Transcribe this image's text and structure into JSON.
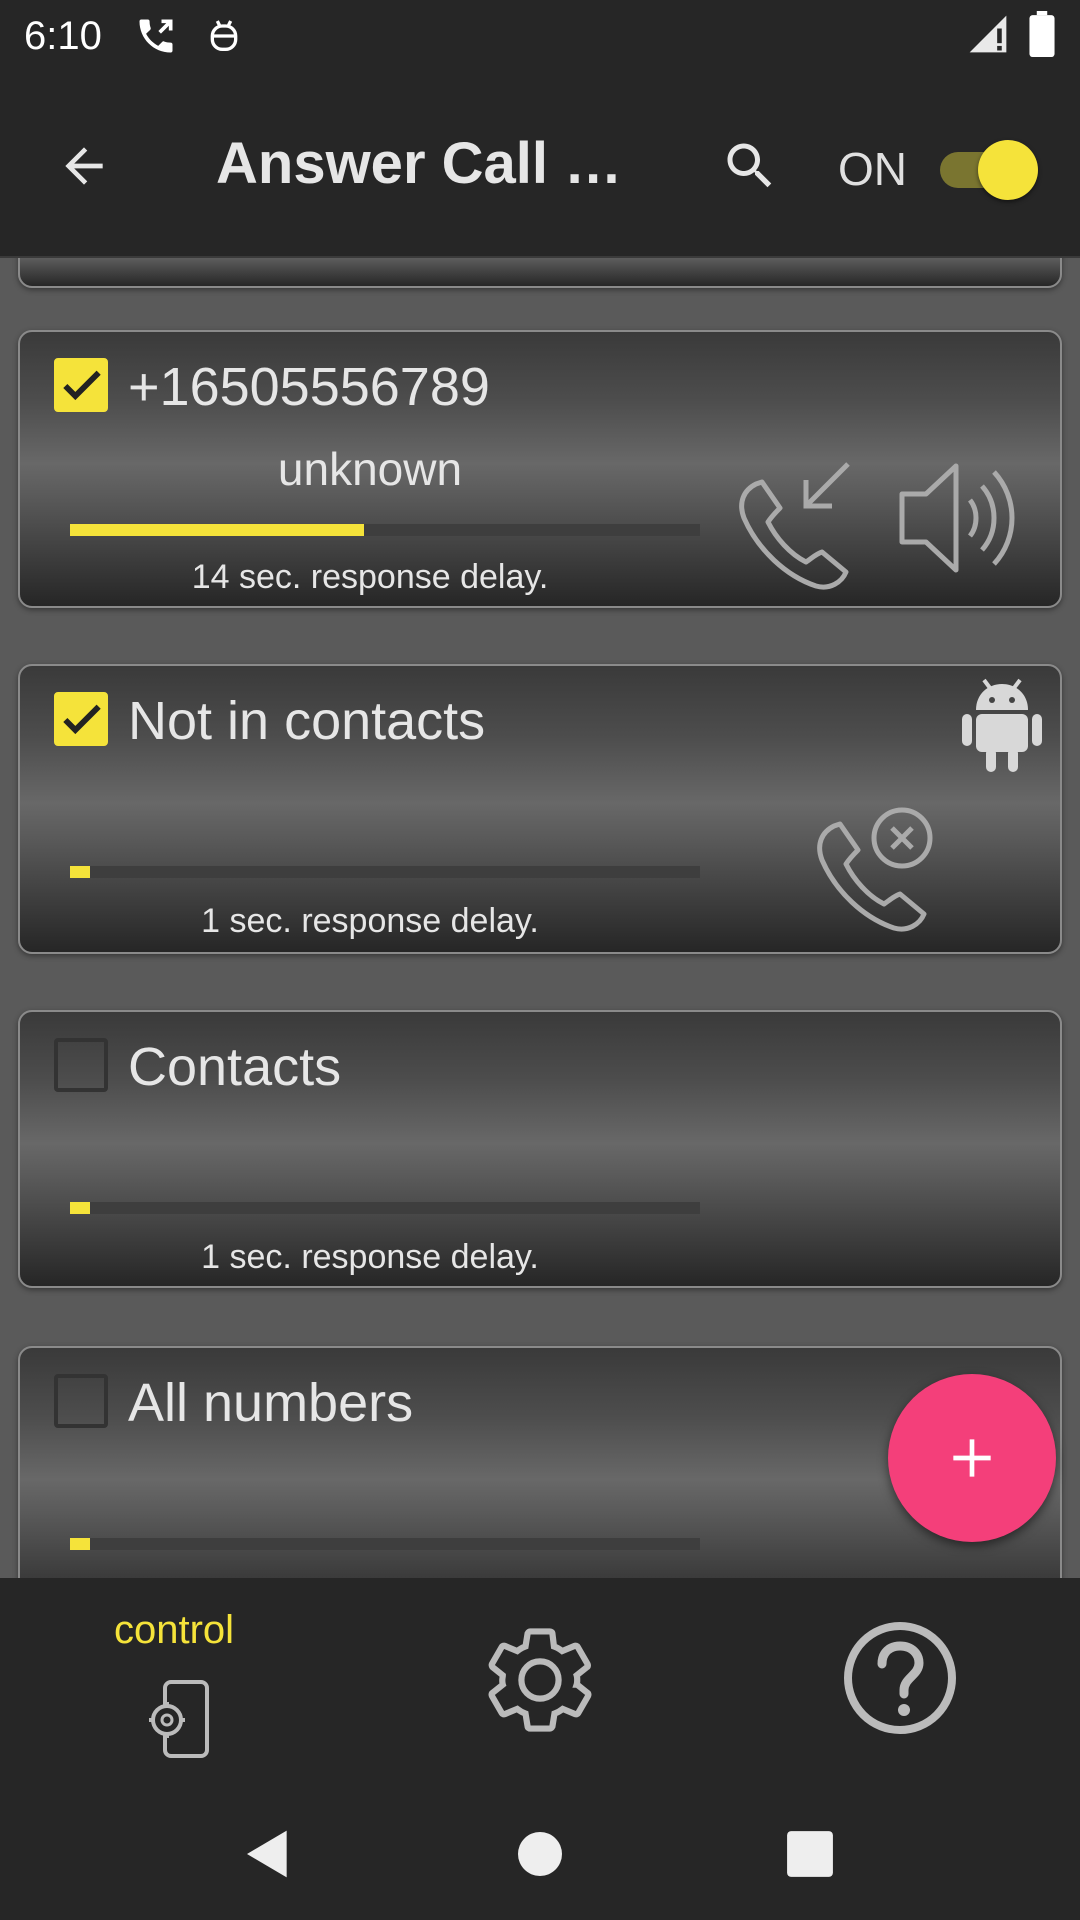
{
  "status_bar": {
    "time": "6:10",
    "icons": [
      "phone-forwarded-icon",
      "android-debug-icon",
      "signal-icon",
      "battery-icon"
    ]
  },
  "app_bar": {
    "title": "Answer Call b…",
    "toggle_label": "ON",
    "toggle_on": true
  },
  "rules": [
    {
      "title": "+16505556789",
      "subtitle": "unknown",
      "checked": true,
      "progress": 0.47,
      "delay_text": "14 sec. response delay.",
      "icons": [
        "incoming-call-icon",
        "speaker-icon"
      ]
    },
    {
      "title": "Not in contacts",
      "subtitle": "",
      "checked": true,
      "progress": 0.03,
      "delay_text": "1 sec. response delay.",
      "icons": [
        "android-icon",
        "call-blocked-icon"
      ]
    },
    {
      "title": "Contacts",
      "subtitle": "",
      "checked": false,
      "progress": 0.03,
      "delay_text": "1 sec. response delay.",
      "icons": []
    },
    {
      "title": "All numbers",
      "subtitle": "",
      "checked": false,
      "progress": 0.03,
      "delay_text": "",
      "icons": []
    }
  ],
  "fab": {
    "icon": "plus-icon"
  },
  "bottom_nav": {
    "items": [
      {
        "label": "control",
        "icon": "phone-settings-icon",
        "active": true
      },
      {
        "label": "",
        "icon": "gear-icon",
        "active": false
      },
      {
        "label": "",
        "icon": "help-icon",
        "active": false
      }
    ]
  },
  "system_nav": {
    "icons": [
      "back-icon",
      "home-icon",
      "recents-icon"
    ]
  },
  "colors": {
    "accent": "#f5e33a",
    "fab": "#f43f7a",
    "bar": "#262626"
  }
}
